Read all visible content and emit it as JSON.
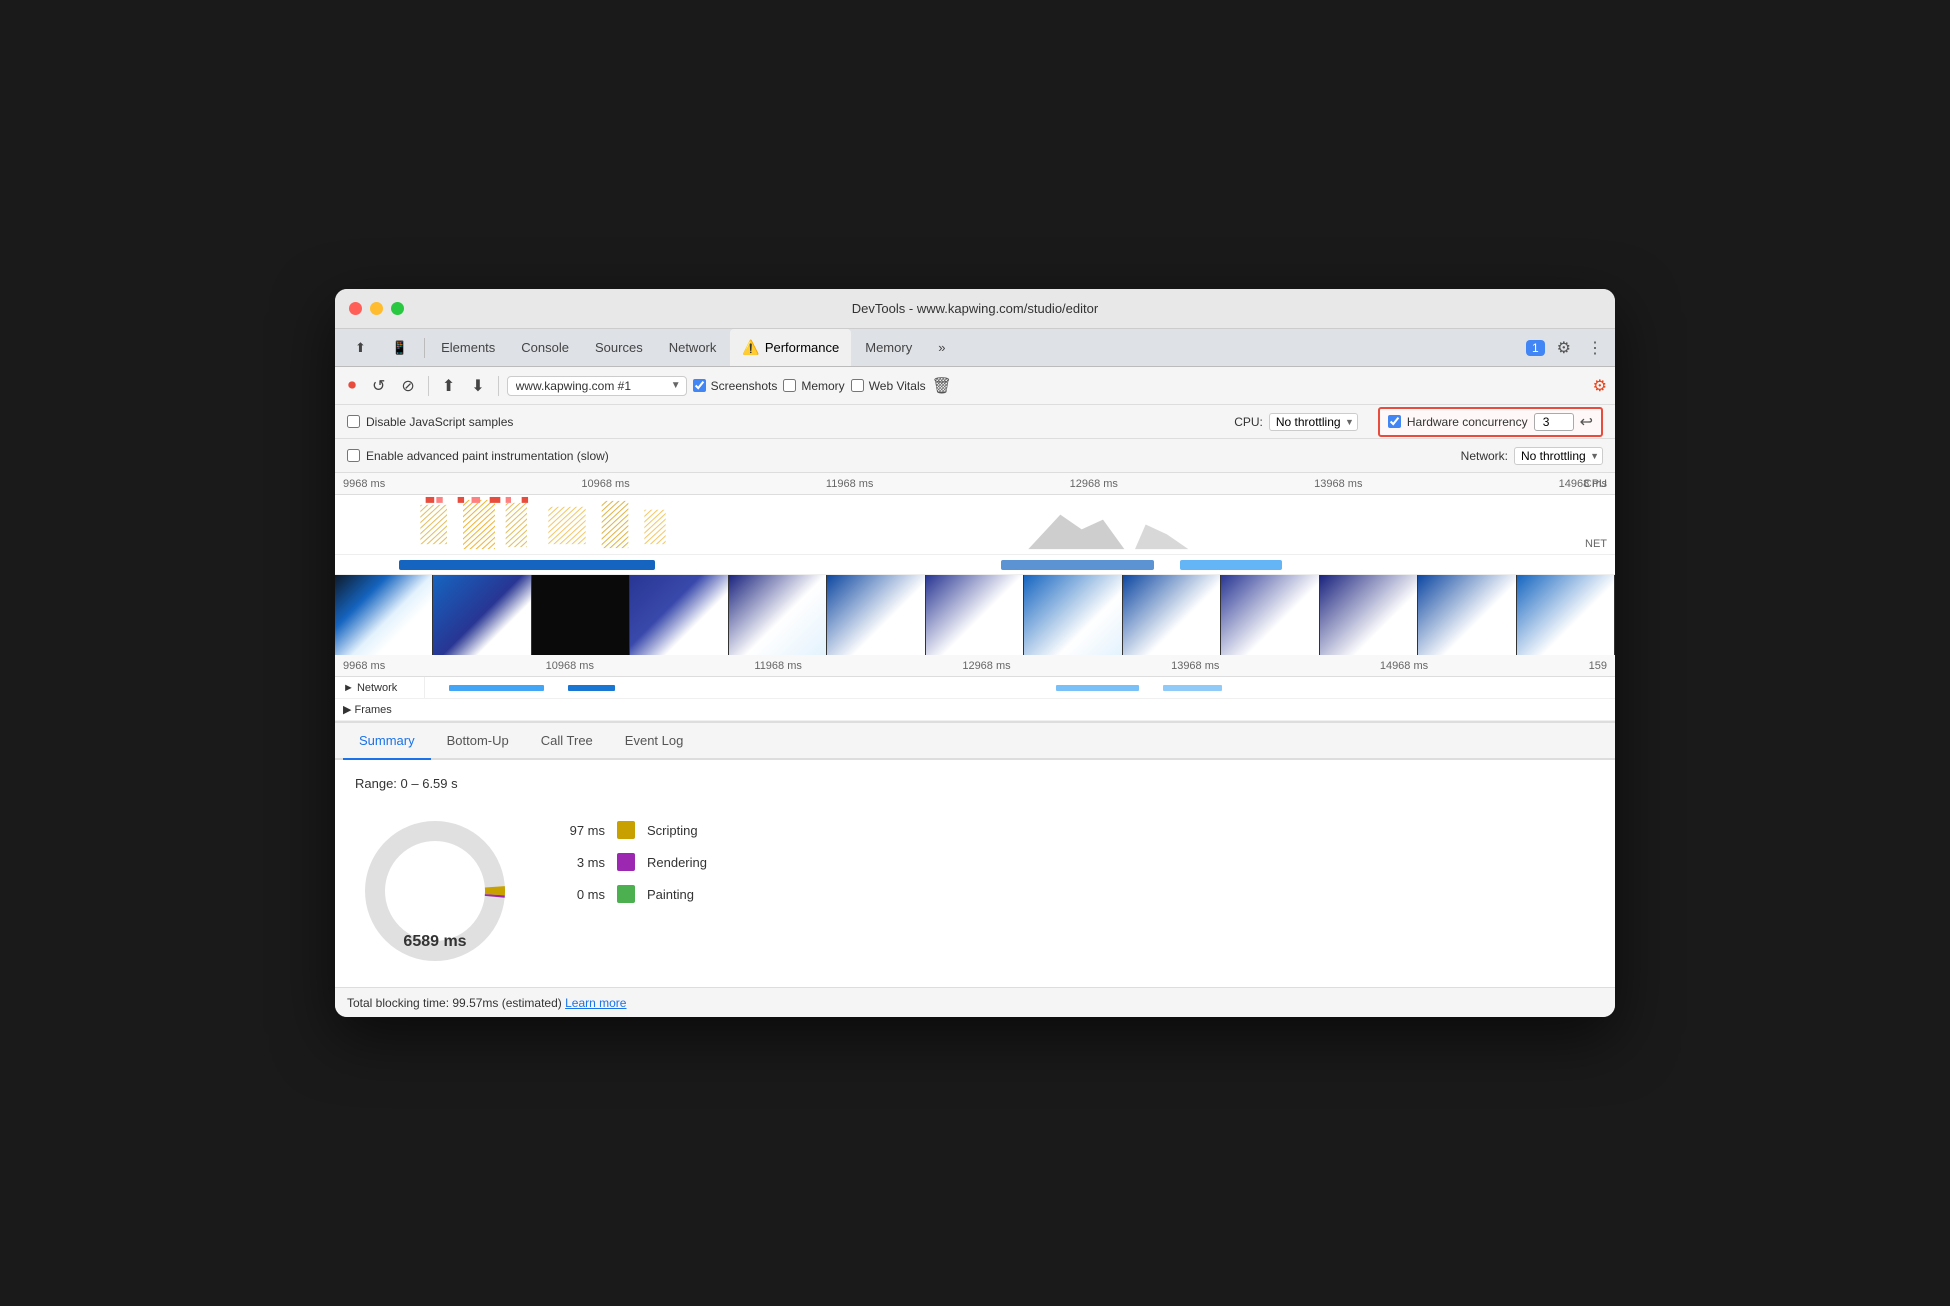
{
  "window": {
    "title": "DevTools - www.kapwing.com/studio/editor"
  },
  "tabs": {
    "items": [
      {
        "label": "Elements",
        "active": false
      },
      {
        "label": "Console",
        "active": false
      },
      {
        "label": "Sources",
        "active": false
      },
      {
        "label": "Network",
        "active": false
      },
      {
        "label": "Performance",
        "active": true,
        "hasWarning": true
      },
      {
        "label": "Memory",
        "active": false
      },
      {
        "label": "»",
        "active": false
      }
    ],
    "badge": "1"
  },
  "toolbar": {
    "url": "www.kapwing.com #1",
    "screenshots_label": "Screenshots",
    "memory_label": "Memory",
    "web_vitals_label": "Web Vitals"
  },
  "settings": {
    "disable_js_samples": "Disable JavaScript samples",
    "advanced_paint": "Enable advanced paint instrumentation (slow)",
    "cpu_label": "CPU:",
    "cpu_throttle": "No throttling",
    "network_label": "Network:",
    "network_throttle": "No throttling",
    "hw_concurrency_label": "Hardware concurrency",
    "hw_concurrency_value": "3"
  },
  "timeline": {
    "ruler_labels": [
      "9968 ms",
      "10968 ms",
      "11968 ms",
      "12968 ms",
      "13968 ms",
      "14968 ms"
    ],
    "ruler_labels_bottom": [
      "9968 ms",
      "10968 ms",
      "11968 ms",
      "12968 ms",
      "13968 ms",
      "14968 ms",
      "159"
    ],
    "cpu_label": "CPU",
    "net_label": "NET"
  },
  "tracks": {
    "network_label": "► Network",
    "frames_label": "► Frames"
  },
  "analysis_tabs": {
    "items": [
      {
        "label": "Summary",
        "active": true
      },
      {
        "label": "Bottom-Up",
        "active": false
      },
      {
        "label": "Call Tree",
        "active": false
      },
      {
        "label": "Event Log",
        "active": false
      }
    ]
  },
  "summary": {
    "range": "Range: 0 – 6.59 s",
    "pie_label": "6589 ms",
    "legend": [
      {
        "value": "97 ms",
        "color": "#c8a000",
        "label": "Scripting"
      },
      {
        "value": "3 ms",
        "color": "#9c27b0",
        "label": "Rendering"
      },
      {
        "value": "0 ms",
        "color": "#4caf50",
        "label": "Painting"
      }
    ]
  },
  "status_bar": {
    "text": "Total blocking time: 99.57ms (estimated)",
    "link": "Learn more"
  }
}
